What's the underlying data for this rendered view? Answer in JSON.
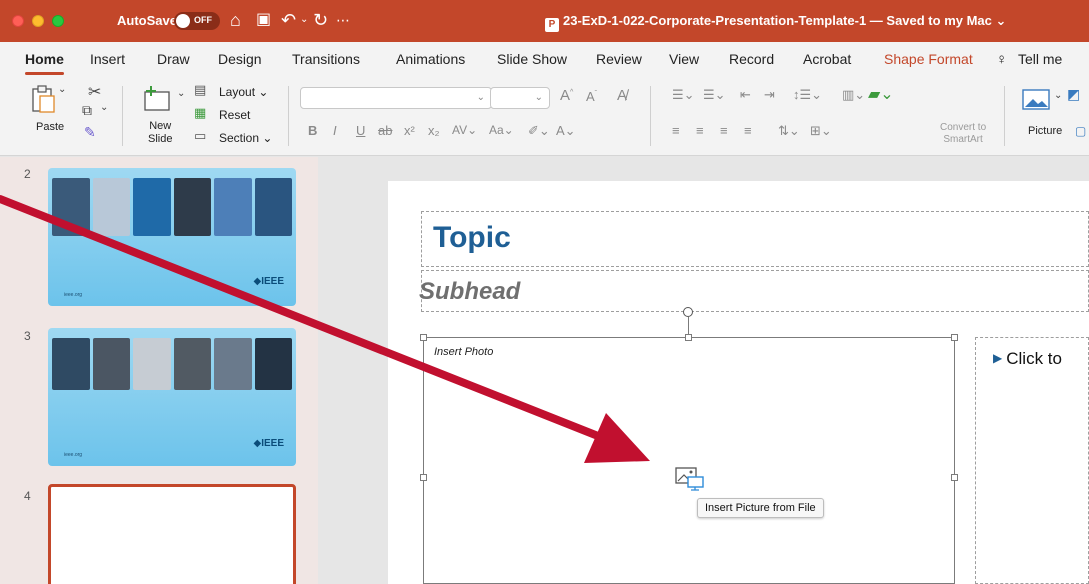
{
  "titlebar": {
    "autosave_label": "AutoSave",
    "autosave_state": "OFF",
    "document_title": "23-ExD-1-022-Corporate-Presentation-Template-1 — Saved to my Mac ⌄"
  },
  "tabs": [
    {
      "label": "Home"
    },
    {
      "label": "Insert"
    },
    {
      "label": "Draw"
    },
    {
      "label": "Design"
    },
    {
      "label": "Transitions"
    },
    {
      "label": "Animations"
    },
    {
      "label": "Slide Show"
    },
    {
      "label": "Review"
    },
    {
      "label": "View"
    },
    {
      "label": "Record"
    },
    {
      "label": "Acrobat"
    },
    {
      "label": "Shape Format"
    },
    {
      "label": "Tell me"
    }
  ],
  "ribbon": {
    "paste": "Paste",
    "new_slide_1": "New",
    "new_slide_2": "Slide",
    "layout": "Layout ⌄",
    "reset": "Reset",
    "section": "Section ⌄",
    "convert_1": "Convert to",
    "convert_2": "SmartArt",
    "picture": "Picture"
  },
  "panel": {
    "slides": [
      {
        "number": "2",
        "logo": "◆IEEE"
      },
      {
        "number": "3",
        "logo": "◆IEEE"
      },
      {
        "number": "4"
      }
    ]
  },
  "slide": {
    "topic": "Topic",
    "subhead": "Subhead",
    "insert_photo": "Insert Photo",
    "click_to": "Click to",
    "tooltip": "Insert Picture from File"
  },
  "colors": {
    "accent": "#c3472a",
    "title_blue": "#1f5f95",
    "arrow": "#c1102f"
  }
}
